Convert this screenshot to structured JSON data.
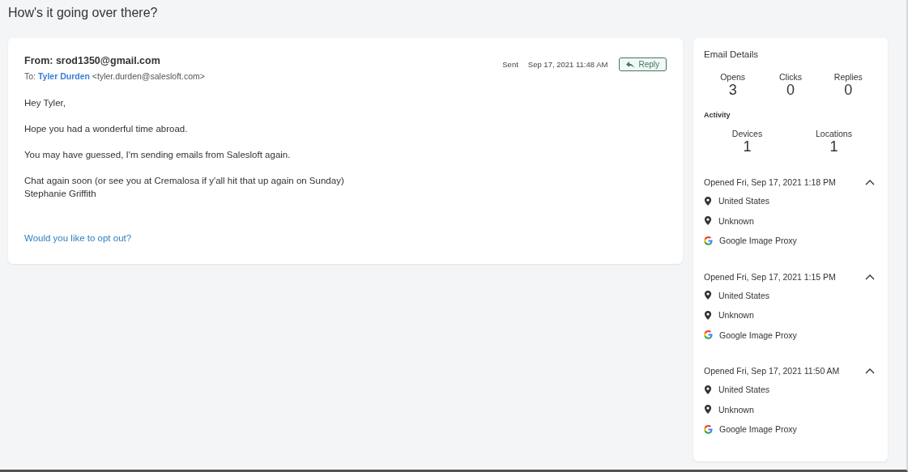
{
  "page_title": "How's it going over there?",
  "email": {
    "from_label": "From:",
    "from": "srod1350@gmail.com",
    "to_label": "To:",
    "to_name": "Tyler Durden",
    "to_address": "<tyler.durden@salesloft.com>",
    "sent_label": "Sent",
    "sent_date": "Sep 17, 2021 11:48 AM",
    "reply_button": "Reply",
    "paragraphs": [
      [
        "Hey Tyler,"
      ],
      [
        "Hope you had a wonderful time abroad."
      ],
      [
        "You may have guessed, I'm sending emails from Salesloft again."
      ],
      [
        "Chat again soon (or see you at Cremalosa if y'all hit that up again on Sunday)",
        "Stephanie Griffith"
      ]
    ],
    "opt_out_link": "Would you like to opt out?"
  },
  "details": {
    "title": "Email Details",
    "stats": [
      {
        "label": "Opens",
        "value": "3"
      },
      {
        "label": "Clicks",
        "value": "0"
      },
      {
        "label": "Replies",
        "value": "0"
      }
    ],
    "activity_label": "Activity",
    "activity": [
      {
        "label": "Devices",
        "value": "1"
      },
      {
        "label": "Locations",
        "value": "1"
      }
    ],
    "opens": [
      {
        "title": "Opened Fri, Sep 17, 2021 1:18 PM",
        "expanded": true,
        "items": [
          {
            "kind": "location",
            "text": "United States"
          },
          {
            "kind": "location",
            "text": "Unknown"
          },
          {
            "kind": "google",
            "text": "Google Image Proxy"
          }
        ]
      },
      {
        "title": "Opened Fri, Sep 17, 2021 1:15 PM",
        "expanded": true,
        "items": [
          {
            "kind": "location",
            "text": "United States"
          },
          {
            "kind": "location",
            "text": "Unknown"
          },
          {
            "kind": "google",
            "text": "Google Image Proxy"
          }
        ]
      },
      {
        "title": "Opened Fri, Sep 17, 2021 11:50 AM",
        "expanded": true,
        "items": [
          {
            "kind": "location",
            "text": "United States"
          },
          {
            "kind": "location",
            "text": "Unknown"
          },
          {
            "kind": "google",
            "text": "Google Image Proxy"
          }
        ]
      }
    ]
  }
}
